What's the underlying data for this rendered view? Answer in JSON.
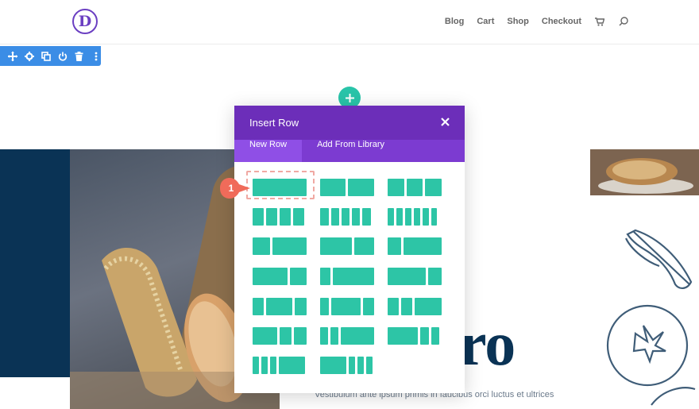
{
  "header": {
    "logo_letter": "D",
    "nav": [
      "Blog",
      "Cart",
      "Shop",
      "Checkout"
    ],
    "icons": [
      "cart-icon",
      "search-icon"
    ]
  },
  "section_toolbar": {
    "icons": [
      "move-icon",
      "settings-icon",
      "duplicate-icon",
      "power-icon",
      "trash-icon",
      "more-icon"
    ]
  },
  "modal": {
    "title": "Insert Row",
    "tabs": [
      "New Row",
      "Add From Library"
    ],
    "active_tab": "New Row"
  },
  "callout": {
    "number": "1"
  },
  "page": {
    "heading_fragment": "ro",
    "body_text": "Vestibulum ante ipsum primis in faucibus orci luctus et ultrices"
  },
  "colors": {
    "brand_purple": "#6c2eb9",
    "tab_purple": "#7c3bd1",
    "layout_teal": "#2dc5a6",
    "toolbar_blue": "#3b8de6",
    "navy": "#0a3355",
    "callout_red": "#f06b5a"
  }
}
